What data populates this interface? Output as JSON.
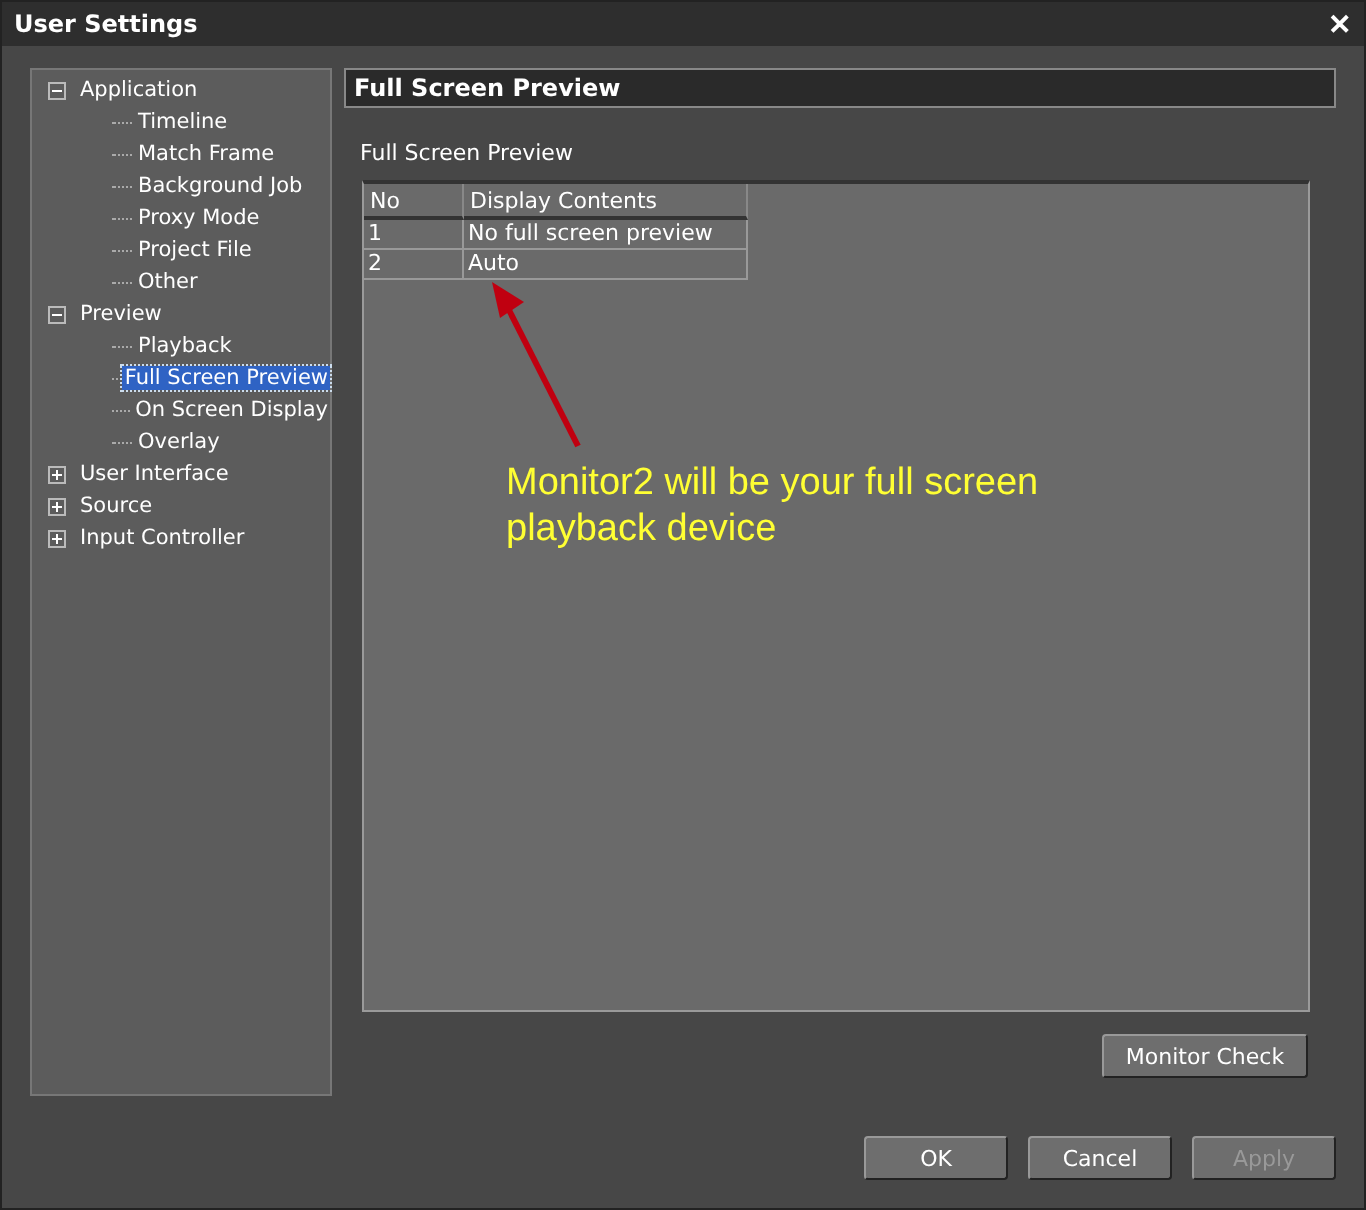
{
  "window": {
    "title": "User Settings",
    "close": "✕"
  },
  "tree": [
    {
      "label": "Application",
      "expanded": true,
      "selected": false,
      "children": [
        {
          "label": "Timeline",
          "selected": false
        },
        {
          "label": "Match Frame",
          "selected": false
        },
        {
          "label": "Background Job",
          "selected": false
        },
        {
          "label": "Proxy Mode",
          "selected": false
        },
        {
          "label": "Project File",
          "selected": false
        },
        {
          "label": "Other",
          "selected": false
        }
      ]
    },
    {
      "label": "Preview",
      "expanded": true,
      "selected": false,
      "children": [
        {
          "label": "Playback",
          "selected": false
        },
        {
          "label": "Full Screen Preview",
          "selected": true
        },
        {
          "label": "On Screen Display",
          "selected": false
        },
        {
          "label": "Overlay",
          "selected": false
        }
      ]
    },
    {
      "label": "User Interface",
      "expanded": false,
      "selected": false
    },
    {
      "label": "Source",
      "expanded": false,
      "selected": false
    },
    {
      "label": "Input Controller",
      "expanded": false,
      "selected": false
    }
  ],
  "panel": {
    "header": "Full Screen Preview",
    "group_label": "Full Screen Preview",
    "table": {
      "columns": [
        "No",
        "Display Contents"
      ],
      "rows": [
        [
          "1",
          "No full screen preview"
        ],
        [
          "2",
          "Auto"
        ]
      ]
    },
    "annotation": "Monitor2 will be your full screen playback device",
    "monitor_check": "Monitor Check"
  },
  "buttons": [
    {
      "label": "OK",
      "disabled": false
    },
    {
      "label": "Cancel",
      "disabled": false
    },
    {
      "label": "Apply",
      "disabled": true
    }
  ]
}
